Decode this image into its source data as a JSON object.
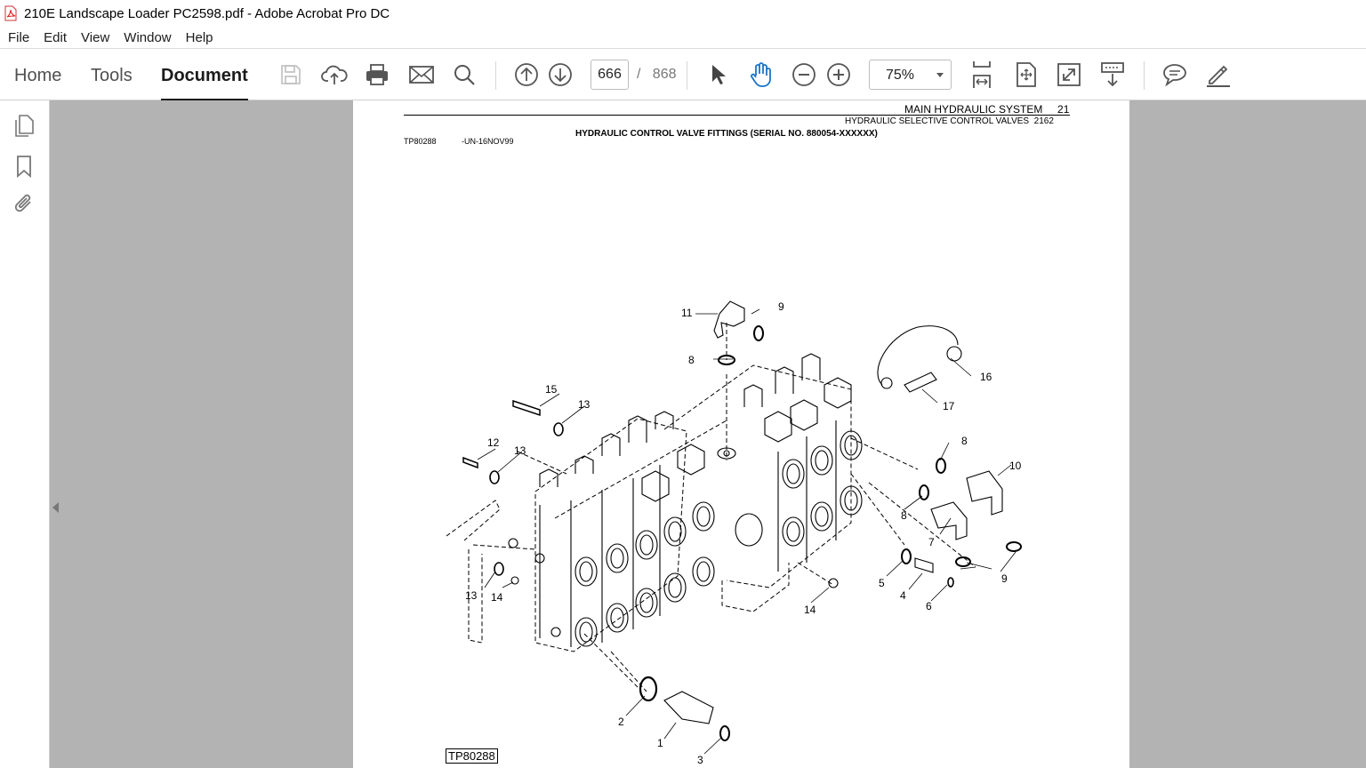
{
  "window": {
    "title": "210E Landscape Loader PC2598.pdf - Adobe Acrobat Pro DC"
  },
  "menu": [
    "File",
    "Edit",
    "View",
    "Window",
    "Help"
  ],
  "nav_tabs": {
    "home": "Home",
    "tools": "Tools",
    "document": "Document"
  },
  "toolbar": {
    "current_page": "666",
    "page_separator": "/",
    "total_pages": "868",
    "zoom": "75%",
    "icons": [
      "save-icon",
      "upload-icon",
      "print-icon",
      "email-icon",
      "search-icon",
      "page-up-icon",
      "page-down-icon",
      "select-pointer-icon",
      "hand-icon",
      "zoom-out-icon",
      "zoom-in-icon",
      "fit-width-icon",
      "fit-page-icon",
      "fullscreen-icon",
      "scroll-mode-icon",
      "comment-icon",
      "sign-icon"
    ]
  },
  "left_panel": {
    "icons": [
      "page-thumbnails-icon",
      "bookmarks-icon",
      "attachments-icon"
    ]
  },
  "document": {
    "header_system": "MAIN HYDRAULIC SYSTEM",
    "header_system_no": "21",
    "header_subsystem": "HYDRAULIC SELECTIVE CONTROL VALVES",
    "header_subsystem_no": "2162",
    "title": "HYDRAULIC CONTROL VALVE FITTINGS (SERIAL NO. 880054-XXXXXX)",
    "figure_id": "TP80288",
    "figure_date": "-UN-16NOV99",
    "figure_label": "TP80288",
    "callouts": {
      "c1": "1",
      "c2": "2",
      "c3": "3",
      "c4": "4",
      "c5": "5",
      "c6": "6",
      "c7": "7",
      "c8a": "8",
      "c8b": "8",
      "c8c": "8",
      "c9a": "9",
      "c9b": "9",
      "c10": "10",
      "c11": "11",
      "c12": "12",
      "c13a": "13",
      "c13b": "13",
      "c13c": "13",
      "c14a": "14",
      "c14b": "14",
      "c15": "15",
      "c16": "16",
      "c17": "17"
    }
  }
}
